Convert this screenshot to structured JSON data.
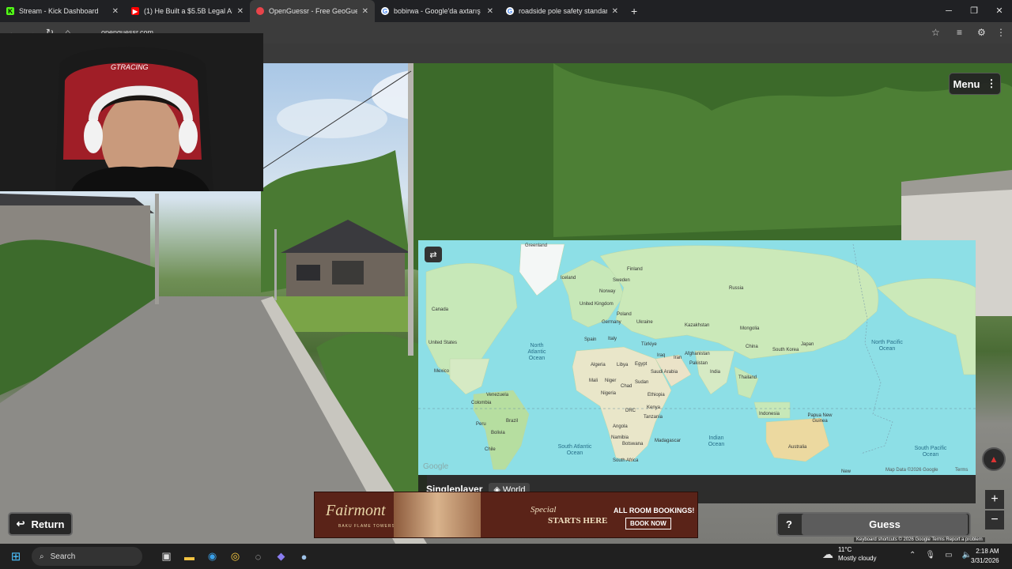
{
  "browser": {
    "tabs": [
      {
        "title": "Stream - Kick Dashboard",
        "icon": "kick-icon",
        "color": "#53fc18",
        "active": false
      },
      {
        "title": "(1) He Built a $5.5B Legal AI Co",
        "icon": "youtube-icon",
        "color": "#ff0000",
        "active": false
      },
      {
        "title": "OpenGuessr - Free GeoGuessr",
        "icon": "openguessr-icon",
        "color": "#e8444a",
        "active": true
      },
      {
        "title": "bobirwa - Google'da axtarış",
        "icon": "google-icon",
        "color": "#ffffff",
        "active": false
      },
      {
        "title": "roadside pole safety standards",
        "icon": "google-icon",
        "color": "#ffffff",
        "active": false
      }
    ],
    "new_tab": "+",
    "url": "openguessr.com"
  },
  "game": {
    "menu_label": "Menu",
    "mode": "Singleplayer",
    "map_name": "World",
    "return_label": "Return",
    "help_label": "?",
    "guess_label": "Guess",
    "zoom_in": "+",
    "zoom_out": "−",
    "credits": "Keyboard shortcuts  © 2026 Google  Terms  Report a problem"
  },
  "map": {
    "google_logo": "Google",
    "attribution": "Map Data ©2026 Google",
    "terms": "Terms",
    "countries": [
      "Greenland",
      "Iceland",
      "Finland",
      "Sweden",
      "Norway",
      "Russia",
      "United Kingdom",
      "Poland",
      "Germany",
      "Ukraine",
      "Kazakhstan",
      "Mongolia",
      "Canada",
      "Spain",
      "Italy",
      "Türkiye",
      "Afghanistan",
      "China",
      "South Korea",
      "Japan",
      "United States",
      "Algeria",
      "Libya",
      "Egypt",
      "Iraq",
      "Iran",
      "Pakistan",
      "Saudi Arabia",
      "India",
      "Mexico",
      "Mali",
      "Niger",
      "Chad",
      "Sudan",
      "Ethiopia",
      "Thailand",
      "Nigeria",
      "Venezuela",
      "Colombia",
      "Kenya",
      "DRC",
      "Tanzania",
      "Indonesia",
      "Papua New Guinea",
      "Peru",
      "Brazil",
      "Bolivia",
      "Angola",
      "Namibia",
      "Botswana",
      "Madagascar",
      "Chile",
      "South Africa",
      "Australia",
      "New"
    ],
    "oceans": [
      "North Atlantic Ocean",
      "North Pacific Ocean",
      "Indian Ocean",
      "South Atlantic Ocean",
      "South Pacific Ocean"
    ]
  },
  "ad": {
    "brand": "Fairmont",
    "sub": "BAKU  FLAME TOWERS",
    "special": "Special",
    "starts": "STARTS HERE",
    "offer": "ALL ROOM BOOKINGS!",
    "cta": "BOOK NOW"
  },
  "taskbar": {
    "search_label": "Search",
    "temperature": "11°C",
    "weather": "Mostly cloudy",
    "time": "2:18 AM",
    "date": "3/31/2026"
  }
}
